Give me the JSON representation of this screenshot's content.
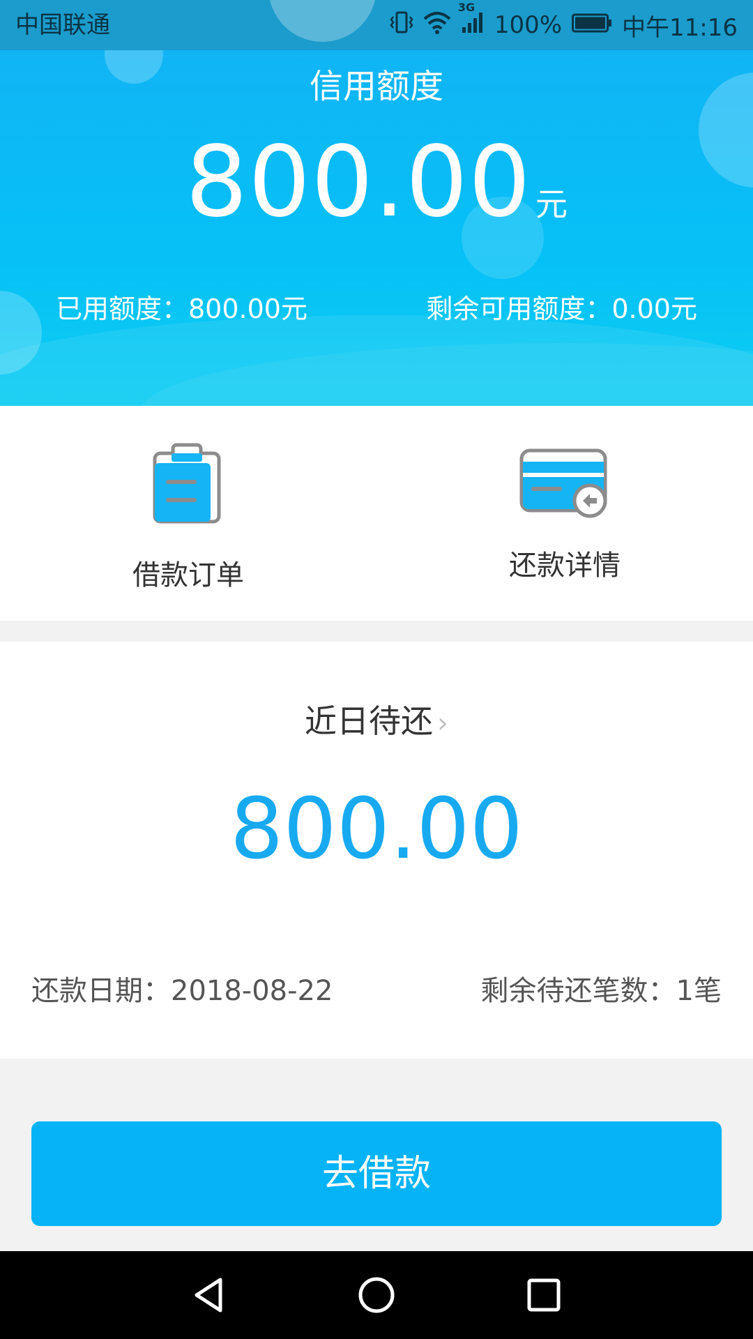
{
  "status_bar": {
    "carrier": "中国联通",
    "network_label": "3G",
    "battery": "100%",
    "time": "中午11:16",
    "icons": [
      "vibrate-icon",
      "wifi-icon",
      "signal-icon",
      "battery-icon"
    ]
  },
  "credit": {
    "title": "信用额度",
    "amount": "800.00",
    "unit": "元",
    "used": "已用额度：800.00元",
    "remaining": "剩余可用额度：0.00元"
  },
  "actions": [
    {
      "label": "借款订单",
      "icon": "clipboard-icon"
    },
    {
      "label": "还款详情",
      "icon": "card-return-icon"
    }
  ],
  "due": {
    "title": "近日待还",
    "chevron": "›",
    "amount": "800.00",
    "date": "还款日期：2018-08-22",
    "count": "剩余待还笔数：1笔"
  },
  "primary_button": {
    "label": "去借款"
  },
  "nav_bar": {
    "icons": [
      "back-icon",
      "home-icon",
      "recents-icon"
    ]
  },
  "colors": {
    "accent": "#05b3f6",
    "header_gradient": [
      "#11b4f5",
      "#0ecdf2"
    ],
    "status_bar": "#1b9ccc",
    "due_amount": "#18aaf0",
    "page_background": "#f2f2f2"
  }
}
